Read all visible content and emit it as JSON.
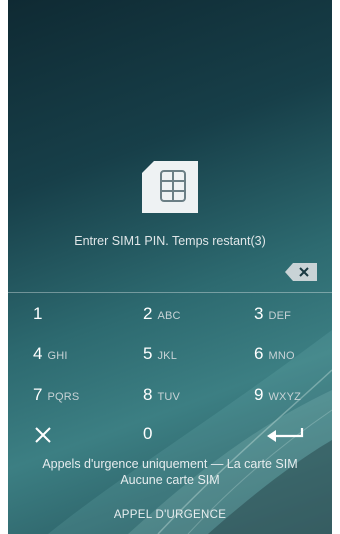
{
  "lock": {
    "message": "Entrer SIM1 PIN. Temps restant(3)",
    "sim_icon": "sim-card-icon",
    "backspace_icon": "backspace-icon"
  },
  "keypad": {
    "k1": {
      "num": "1",
      "letters": ""
    },
    "k2": {
      "num": "2",
      "letters": "ABC"
    },
    "k3": {
      "num": "3",
      "letters": "DEF"
    },
    "k4": {
      "num": "4",
      "letters": "GHI"
    },
    "k5": {
      "num": "5",
      "letters": "JKL"
    },
    "k6": {
      "num": "6",
      "letters": "MNO"
    },
    "k7": {
      "num": "7",
      "letters": "PQRS"
    },
    "k8": {
      "num": "8",
      "letters": "TUV"
    },
    "k9": {
      "num": "9",
      "letters": "WXYZ"
    },
    "k0": {
      "num": "0",
      "letters": ""
    },
    "cancel_icon": "close-icon",
    "enter_icon": "enter-arrow-icon"
  },
  "status": {
    "line1": "Appels d'urgence uniquement — La carte SIM",
    "line2": "Aucune carte SIM"
  },
  "emergency_button": "APPEL D'URGENCE"
}
